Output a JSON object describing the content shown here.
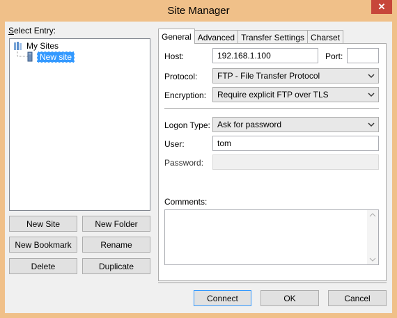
{
  "window": {
    "title": "Site Manager",
    "close_glyph": "✕"
  },
  "left": {
    "select_entry": "Select Entry:",
    "tree": {
      "root": "My Sites",
      "child": "New site"
    },
    "buttons": {
      "new_site": "New Site",
      "new_folder": "New Folder",
      "new_bookmark": "New Bookmark",
      "rename": "Rename",
      "delete": "Delete",
      "duplicate": "Duplicate"
    }
  },
  "tabs": [
    "General",
    "Advanced",
    "Transfer Settings",
    "Charset"
  ],
  "general": {
    "host_label": "Host:",
    "host_value": "192.168.1.100",
    "port_label": "Port:",
    "port_value": "",
    "protocol_label": "Protocol:",
    "protocol_value": "FTP - File Transfer Protocol",
    "encryption_label": "Encryption:",
    "encryption_value": "Require explicit FTP over TLS",
    "logon_label": "Logon Type:",
    "logon_value": "Ask for password",
    "user_label": "User:",
    "user_value": "tom",
    "password_label": "Password:",
    "password_value": "",
    "comments_label": "Comments:",
    "comments_value": ""
  },
  "footer": {
    "connect": "Connect",
    "ok": "OK",
    "cancel": "Cancel"
  }
}
